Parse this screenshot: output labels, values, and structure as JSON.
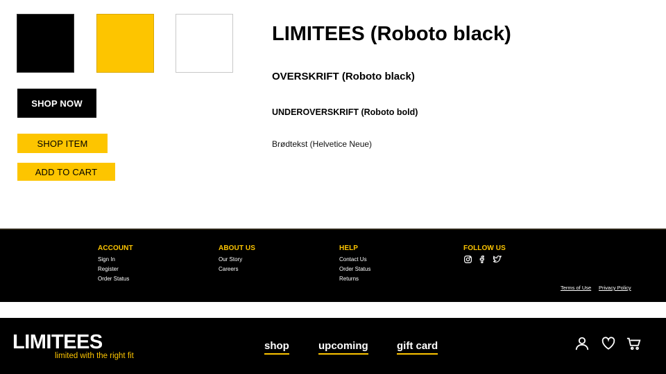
{
  "colors": {
    "black": "#000000",
    "yellow": "#fdc500",
    "white": "#ffffff"
  },
  "buttons": {
    "shop_now": "SHOP NOW",
    "shop_item": "SHOP ITEM",
    "add_to_cart": "ADD TO CART"
  },
  "typography": {
    "h1": "LIMITEES (Roboto black)",
    "h2": "OVERSKRIFT (Roboto black)",
    "h3": "UNDEROVERSKRIFT (Roboto bold)",
    "body": "Brødtekst (Helvetice Neue)"
  },
  "footer": {
    "account": {
      "title": "ACCOUNT",
      "links": [
        "Sign In",
        "Register",
        "Order Status"
      ]
    },
    "about": {
      "title": "ABOUT US",
      "links": [
        "Our Story",
        "Careers"
      ]
    },
    "help": {
      "title": "HELP",
      "links": [
        "Contact Us",
        "Order Status",
        "Returns"
      ]
    },
    "follow": {
      "title": "FOLLOW US",
      "icons": [
        "instagram-icon",
        "facebook-icon",
        "twitter-icon"
      ]
    },
    "terms": "Terms of Use",
    "privacy": "Privacy Policy"
  },
  "navbar": {
    "logo": "LIMITEES",
    "tagline": "limited with the right fit",
    "links": [
      "shop",
      "upcoming",
      "gift card"
    ],
    "icons": [
      "user-icon",
      "heart-icon",
      "cart-icon"
    ]
  }
}
